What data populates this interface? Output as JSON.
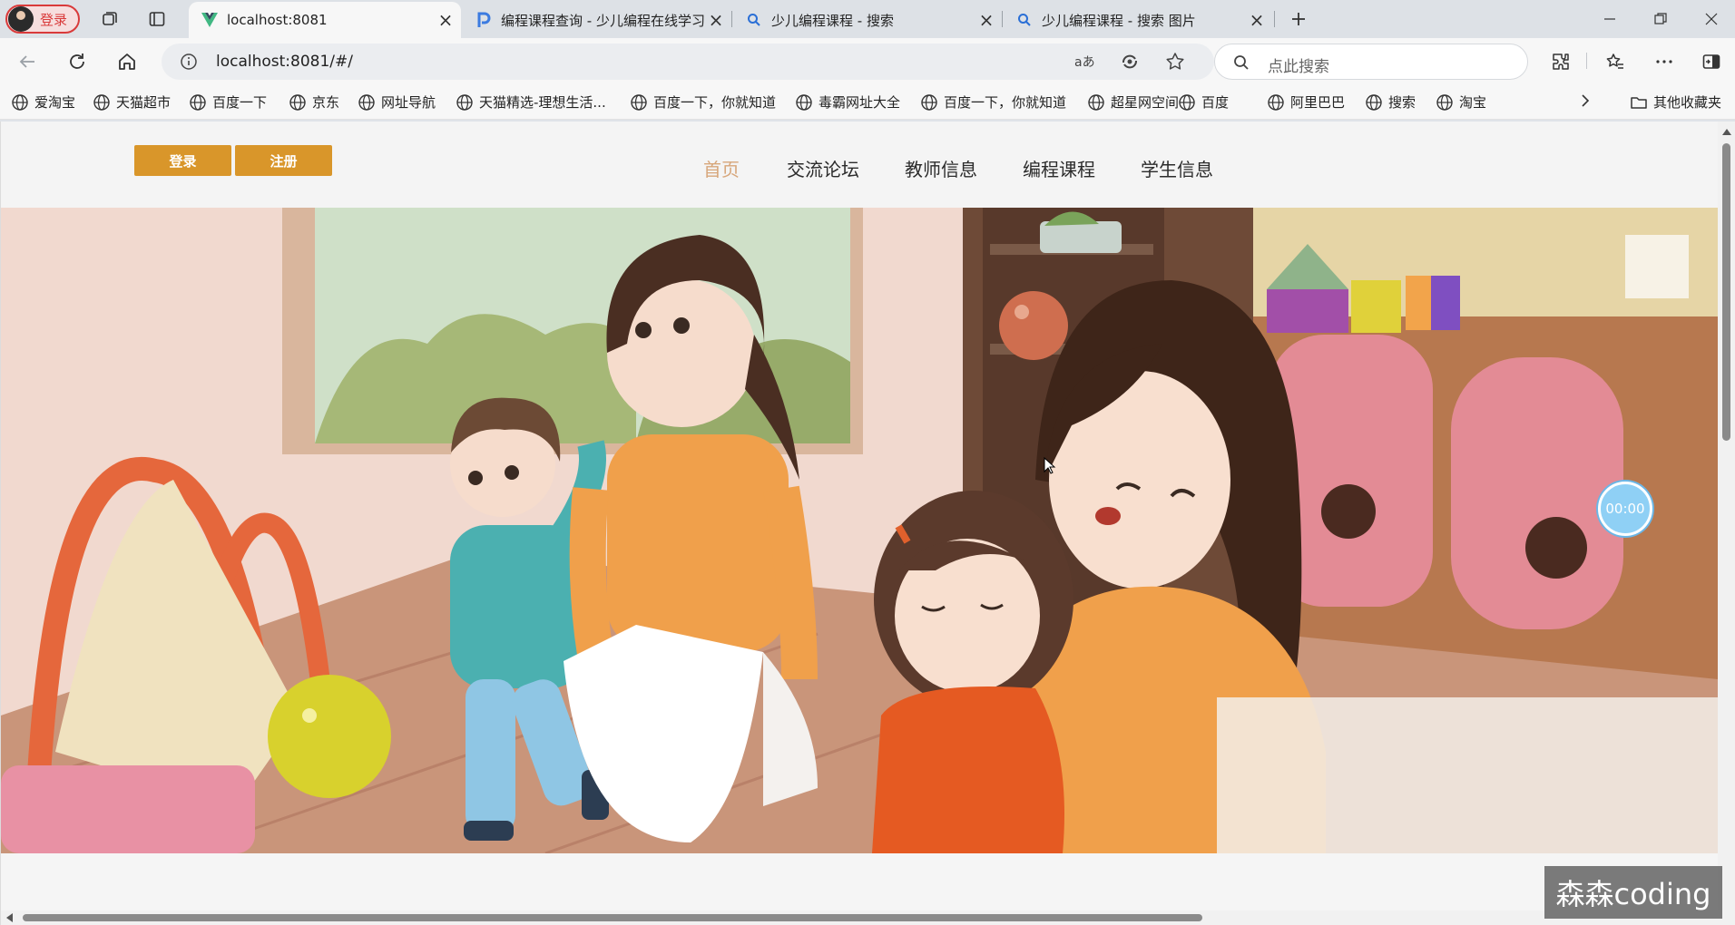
{
  "browser": {
    "profile": {
      "label": "登录"
    },
    "tabs": [
      {
        "title": "localhost:8081",
        "favicon": "vue-logo-icon",
        "active": true
      },
      {
        "title": "编程课程查询 - 少儿编程在线学习",
        "favicon": "p-logo-icon",
        "active": false
      },
      {
        "title": "少儿编程课程 - 搜索",
        "favicon": "search-icon",
        "active": false
      },
      {
        "title": "少儿编程课程 - 搜索 图片",
        "favicon": "search-icon",
        "active": false
      }
    ],
    "address": {
      "url": "localhost:8081/#/"
    },
    "search": {
      "placeholder": "点此搜索"
    },
    "bookmarks": [
      "爱淘宝",
      "天猫超市",
      "百度一下",
      "京东",
      "网址导航",
      "天猫精选-理想生活...",
      "百度一下，你就知道",
      "毒霸网址大全",
      "百度一下，你就知道",
      "超星网空间",
      "百度",
      "阿里巴巴",
      "搜索",
      "淘宝"
    ],
    "other_bookmarks": "其他收藏夹"
  },
  "site": {
    "auth": {
      "login": "登录",
      "register": "注册"
    },
    "nav": [
      "首页",
      "交流论坛",
      "教师信息",
      "编程课程",
      "学生信息"
    ],
    "active_nav": "首页",
    "timer": "00:00"
  },
  "watermark": "森森coding",
  "colors": {
    "accent": "#d9962a",
    "nav_active": "#d7a67a",
    "timer": "#8fd0f5"
  }
}
